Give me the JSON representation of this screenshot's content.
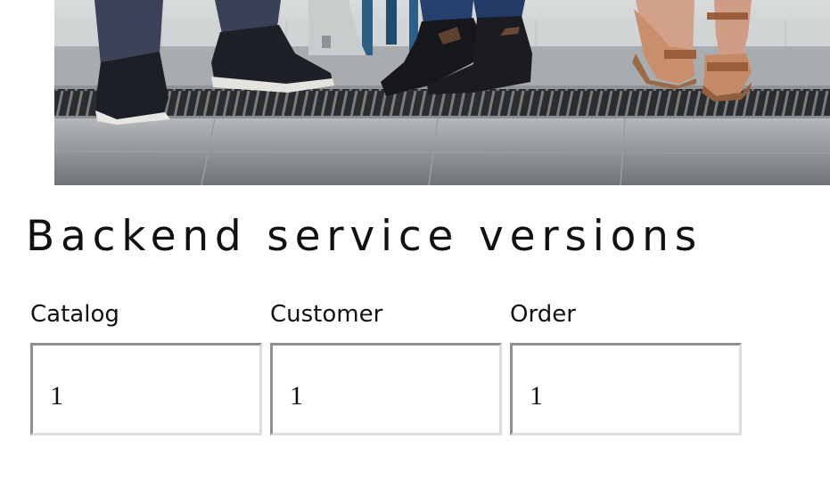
{
  "hero": {
    "image": "people-sneakers-sandals-photo"
  },
  "heading": "Backend service versions",
  "fields": [
    {
      "label": "Catalog",
      "value": "1"
    },
    {
      "label": "Customer",
      "value": "1"
    },
    {
      "label": "Order",
      "value": "1"
    }
  ]
}
